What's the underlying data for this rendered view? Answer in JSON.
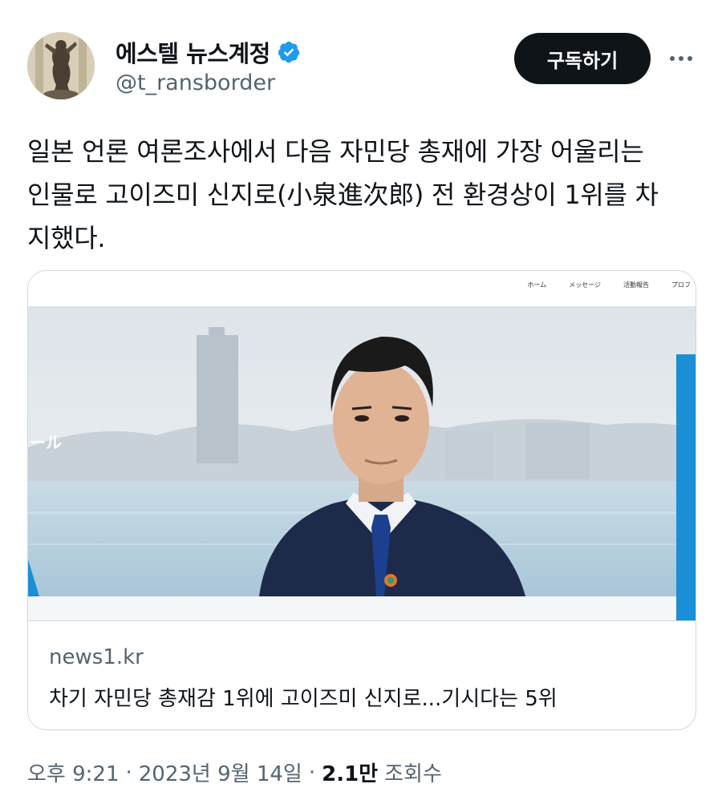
{
  "author": {
    "display_name": "에스텔 뉴스계정",
    "handle": "@t_ransborder",
    "verified": true
  },
  "header": {
    "subscribe_label": "구독하기",
    "more_icon": "more-horizontal-icon"
  },
  "tweet": {
    "lines": [
      "일본 언론 여론조사에서 다음 자민당 총재에 가장 어울리는",
      "인물로 고이즈미 신지로(小泉進次郎) 전 환경상이 1위를 차",
      "지했다."
    ]
  },
  "link_card": {
    "image_nav": [
      "ホーム",
      "メッセージ",
      "活動報告",
      "プロフ"
    ],
    "image_overlay_text": "ール",
    "domain": "news1.kr",
    "title": "차기 자민당 총재감 1위에 고이즈미 신지로...기시다는 5위"
  },
  "meta": {
    "time": "오후 9:21",
    "date": "2023년 9월 14일",
    "views_count": "2.1만",
    "views_label": "조회수"
  },
  "colors": {
    "text_primary": "#0f1419",
    "text_secondary": "#536471",
    "verified_blue": "#1d9bf0",
    "button_bg": "#0f1419",
    "border": "#cfd9de"
  }
}
